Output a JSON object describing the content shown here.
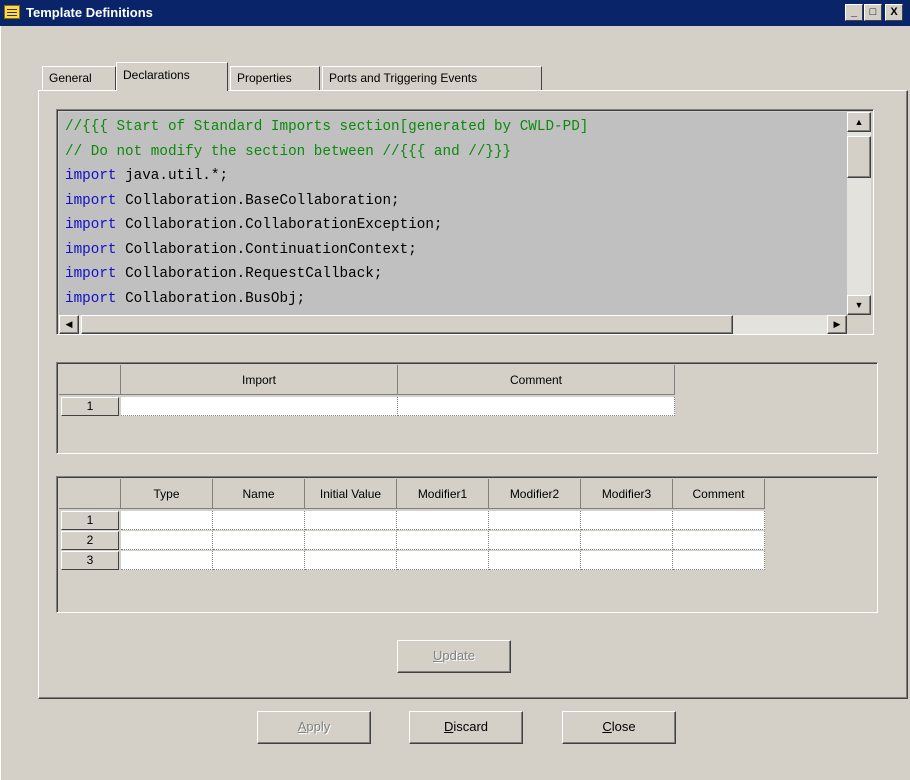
{
  "window": {
    "title": "Template Definitions",
    "controls": [
      "_",
      "□",
      "X"
    ]
  },
  "tabs": [
    {
      "label": "General",
      "active": false
    },
    {
      "label": "Declarations",
      "active": true
    },
    {
      "label": "Properties",
      "active": false
    },
    {
      "label": "Ports and Triggering Events",
      "active": false
    }
  ],
  "code_editor": {
    "lines": [
      {
        "type": "comment",
        "text": "//{{{ Start of Standard Imports section[generated by CWLD-PD]"
      },
      {
        "type": "comment",
        "text": "// Do not modify the section between //{{{ and //}}}"
      },
      {
        "type": "import",
        "keyword": "import",
        "text": " java.util.*;"
      },
      {
        "type": "import",
        "keyword": "import",
        "text": " Collaboration.BaseCollaboration;"
      },
      {
        "type": "import",
        "keyword": "import",
        "text": " Collaboration.CollaborationException;"
      },
      {
        "type": "import",
        "keyword": "import",
        "text": " Collaboration.ContinuationContext;"
      },
      {
        "type": "import",
        "keyword": "import",
        "text": " Collaboration.RequestCallback;"
      },
      {
        "type": "import",
        "keyword": "import",
        "text": " Collaboration.BusObj;"
      }
    ]
  },
  "imports_table": {
    "columns": [
      "Import",
      "Comment"
    ],
    "rows": [
      {
        "num": "1"
      }
    ]
  },
  "vars_table": {
    "columns": [
      "Type",
      "Name",
      "Initial Value",
      "Modifier1",
      "Modifier2",
      "Modifier3",
      "Comment"
    ],
    "rows": [
      {
        "num": "1"
      },
      {
        "num": "2"
      },
      {
        "num": "3"
      }
    ]
  },
  "buttons": {
    "update": {
      "mnemonic": "U",
      "rest": "pdate",
      "enabled": false
    },
    "apply": {
      "mnemonic": "A",
      "rest": "pply",
      "enabled": false
    },
    "discard": {
      "mnemonic": "D",
      "rest": "iscard",
      "enabled": true
    },
    "close": {
      "mnemonic": "C",
      "rest": "lose",
      "enabled": true
    }
  },
  "colors": {
    "titlebar": "#0a246a",
    "window_bg": "#d4d0c8",
    "comment": "#0a8a0a",
    "keyword": "#1010c8"
  }
}
